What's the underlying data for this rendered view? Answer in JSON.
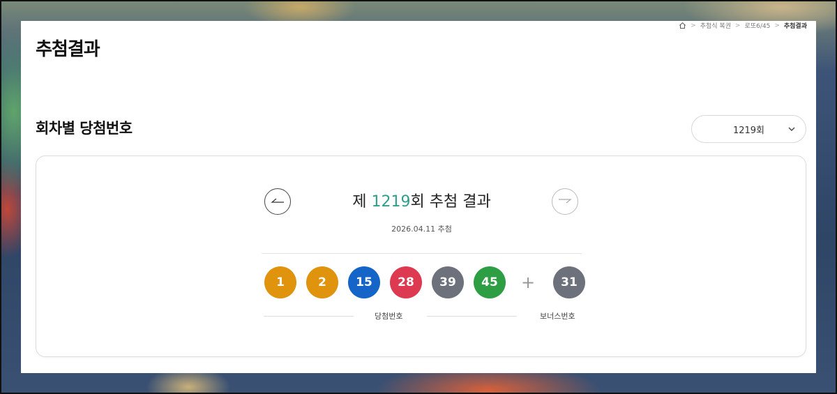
{
  "breadcrumb": {
    "items": [
      "추첨식 복권",
      "로또6/45"
    ],
    "current": "추첨결과"
  },
  "page_title": "추첨결과",
  "section_title": "회차별 당첨번호",
  "round_select": {
    "value": "1219회"
  },
  "result": {
    "title_prefix": "제 ",
    "round_number": "1219",
    "title_suffix": "회 추첨 결과",
    "date": "2026.04.11 추첨",
    "numbers": [
      {
        "value": "1",
        "color": "#e0930c"
      },
      {
        "value": "2",
        "color": "#e0930c"
      },
      {
        "value": "15",
        "color": "#1565c8"
      },
      {
        "value": "28",
        "color": "#dd3a52"
      },
      {
        "value": "39",
        "color": "#6c717c"
      },
      {
        "value": "45",
        "color": "#2e9e45"
      }
    ],
    "plus": "+",
    "bonus": {
      "value": "31",
      "color": "#6c717c"
    },
    "numbers_label": "당첨번호",
    "bonus_label": "보너스번호"
  },
  "icons": {
    "home": "home-icon",
    "prev": "arrow-left-icon",
    "next": "arrow-right-icon",
    "dropdown": "chevron-down-icon"
  }
}
